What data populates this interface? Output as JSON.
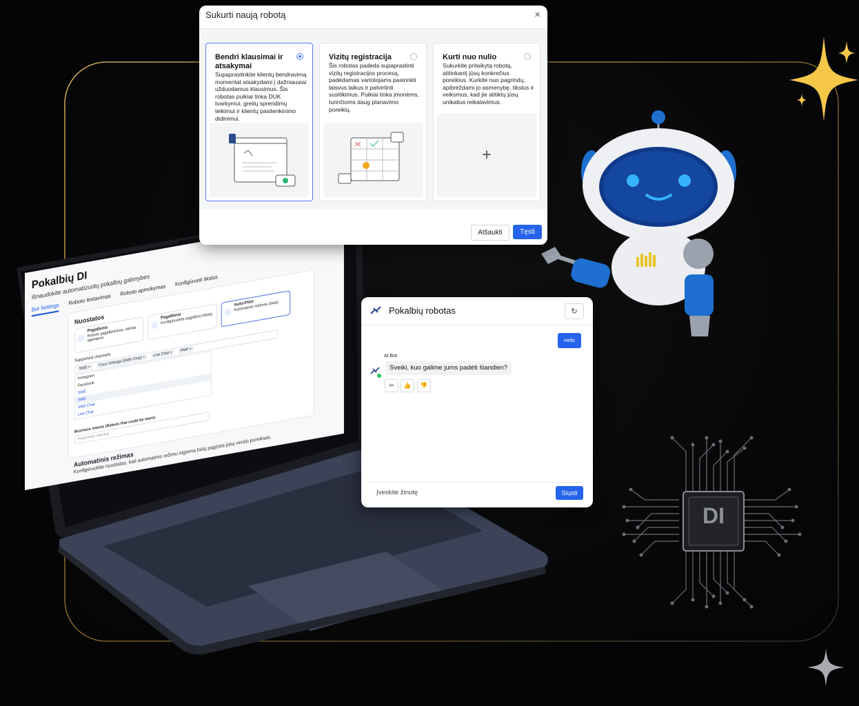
{
  "dialog": {
    "title": "Sukurti naują robotą",
    "close_icon": "×",
    "options": [
      {
        "title": "Bendri klausimai ir atsakymai",
        "description": "Supaprastinkite klientų bendravimą momentat atsakydami į dažniausiai užduodamus klausimus. Šis robotas puikiai tinka DUK tvarkymui, greitų sprendimų teikimui ir klientų pasitenkinimo didinimui.",
        "selected": true
      },
      {
        "title": "Vizitų registracija",
        "description": "Šis robotas padeda supaprastinti vizitų registracijos procesą, padėdamas vartotojams pasirinkti laisvus laikus ir patvirtinti susitikimus. Puikiai tinka įmonėms, turinčioms daug planavimo poreikių.",
        "selected": false
      },
      {
        "title": "Kurti nuo nulio",
        "description": "Sukurkite pritaikytą robotą, atitinkantį jūsų konkrečius poreikius. Kurkite nuo pagrindų, apibrėždami jo asmenybę, tikslus ir veiksmus, kad jie atitiktų jūsų unikalius reikalavimus.",
        "selected": false
      }
    ],
    "plus_icon": "+",
    "cancel_label": "Atšaukti",
    "next_label": "Tęsti"
  },
  "laptop_app": {
    "title": "Pokalbių DI",
    "subtitle": "Išnaudokite automatizuotų pokalbių galimybes",
    "tabs": [
      "Bot Settings",
      "Roboto testavimas",
      "Roboto apmokymas",
      "Konfigūruoti tikslus"
    ],
    "settings_title": "Nuostatos",
    "modes": [
      {
        "title": "Pagalbinis",
        "desc": "Roboto pagalbininkas, skirtas agentams"
      },
      {
        "title": "Pagalbinis",
        "desc": "Konfigūruokite pagalbinį robotą"
      },
      {
        "title": "Auto-Pilot",
        "desc": "Automatinis režimas (beta)"
      }
    ],
    "channels_label": "Supported channels",
    "chips": [
      "SMS ×",
      "Coco-Sritinga (SMS Chat) ×",
      "Live Chat ×",
      "PMP ×"
    ],
    "dropdown": [
      "Instagram",
      "Facebook",
      "SMS",
      "SMS",
      "SMS Chat",
      "Live Chat"
    ],
    "business_label": "Business intents (Robots that could be more)",
    "business_placeholder": "Pasirinkite intentus",
    "auto_title": "Automatinis režimas",
    "auto_sub": "Konfigūruokite nuostatas, kad automatinio režimo elgsena būtų pagrįsta jūsų verslo poreikiais."
  },
  "chat": {
    "title": "Pokalbių robotas",
    "refresh_icon": "↻",
    "user_message": "Hello",
    "bot_name": "AI Bot",
    "bot_message": "Sveiki, kuo galime jums padėti šiandien?",
    "reactions": [
      "✂",
      "👍",
      "👎"
    ],
    "input_placeholder": "Įveskite žinutę",
    "send_label": "Siųsti"
  },
  "chip": {
    "label": "DI"
  },
  "colors": {
    "accent": "#2563eb",
    "frame_gold": "#c9a24a",
    "robot_blue": "#1e6fd0",
    "sparkle": "#f5c84a"
  }
}
